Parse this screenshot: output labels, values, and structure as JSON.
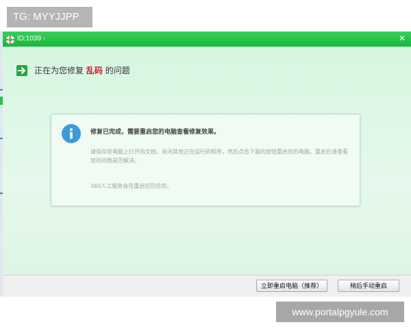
{
  "overlay": {
    "tg_label": "TG: MYYJJPP",
    "watermark": "www.portalpgyule.com"
  },
  "window": {
    "title": "ID:1039 -",
    "close_glyph": "✕",
    "icons": {
      "app": "lifebuoy-icon",
      "header": "arrow-right-icon",
      "info": "info-icon"
    },
    "colors": {
      "titlebar": "#1fbe43",
      "highlight": "#d6162b",
      "info_icon": "#3d9ad9"
    }
  },
  "header": {
    "prefix": "正在为您修复",
    "highlight": "乱码",
    "suffix": "的问题"
  },
  "info": {
    "title": "修复已完成，需要重启您的电脑查看修复效果。",
    "body": "请保存您电脑上打开的文档，关闭其他正在运行的程序，然后点击下面的按钮重启您的电脑。重启后请查看您的问题是否解决。",
    "note": "360人工服务会在重启后回访您。"
  },
  "footer": {
    "restart_button": "立即重启电脑（推荐）",
    "later_button": "稍后手动重启"
  }
}
